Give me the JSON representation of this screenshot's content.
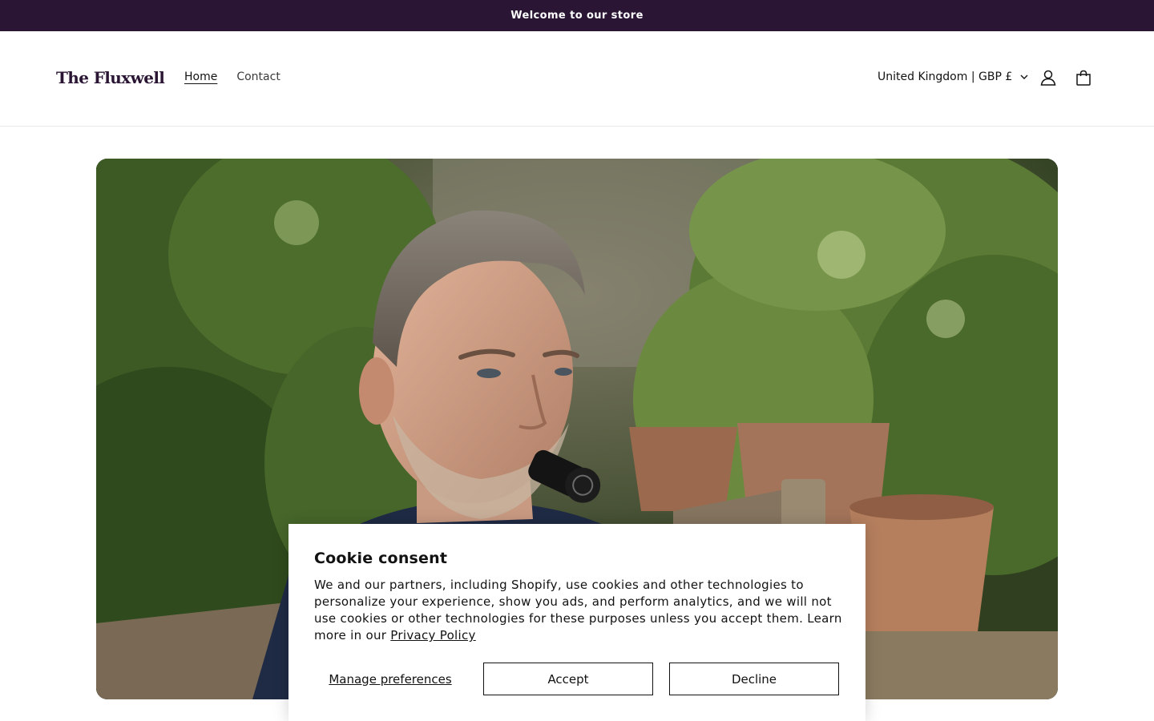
{
  "announcement": {
    "text": "Welcome to our store"
  },
  "header": {
    "logo": "The Fluxwell",
    "nav": [
      {
        "label": "Home",
        "active": true
      },
      {
        "label": "Contact",
        "active": false
      }
    ],
    "locale": "United Kingdom | GBP £",
    "icons": [
      "chevron-down-icon",
      "account-icon",
      "cart-icon"
    ]
  },
  "hero": {
    "image_description_icon": "hero-photo"
  },
  "cookie": {
    "title": "Cookie consent",
    "text": "We and our partners, including Shopify, use cookies and other technologies to personalize your experience, show you ads, and perform analytics, and we will not use cookies or other technologies for these purposes unless you accept them. Learn more in our ",
    "link": "Privacy Policy",
    "manage": "Manage preferences",
    "accept": "Accept",
    "decline": "Decline"
  },
  "colors": {
    "announcement_bg": "#2a1634",
    "logo": "#2a1634"
  }
}
